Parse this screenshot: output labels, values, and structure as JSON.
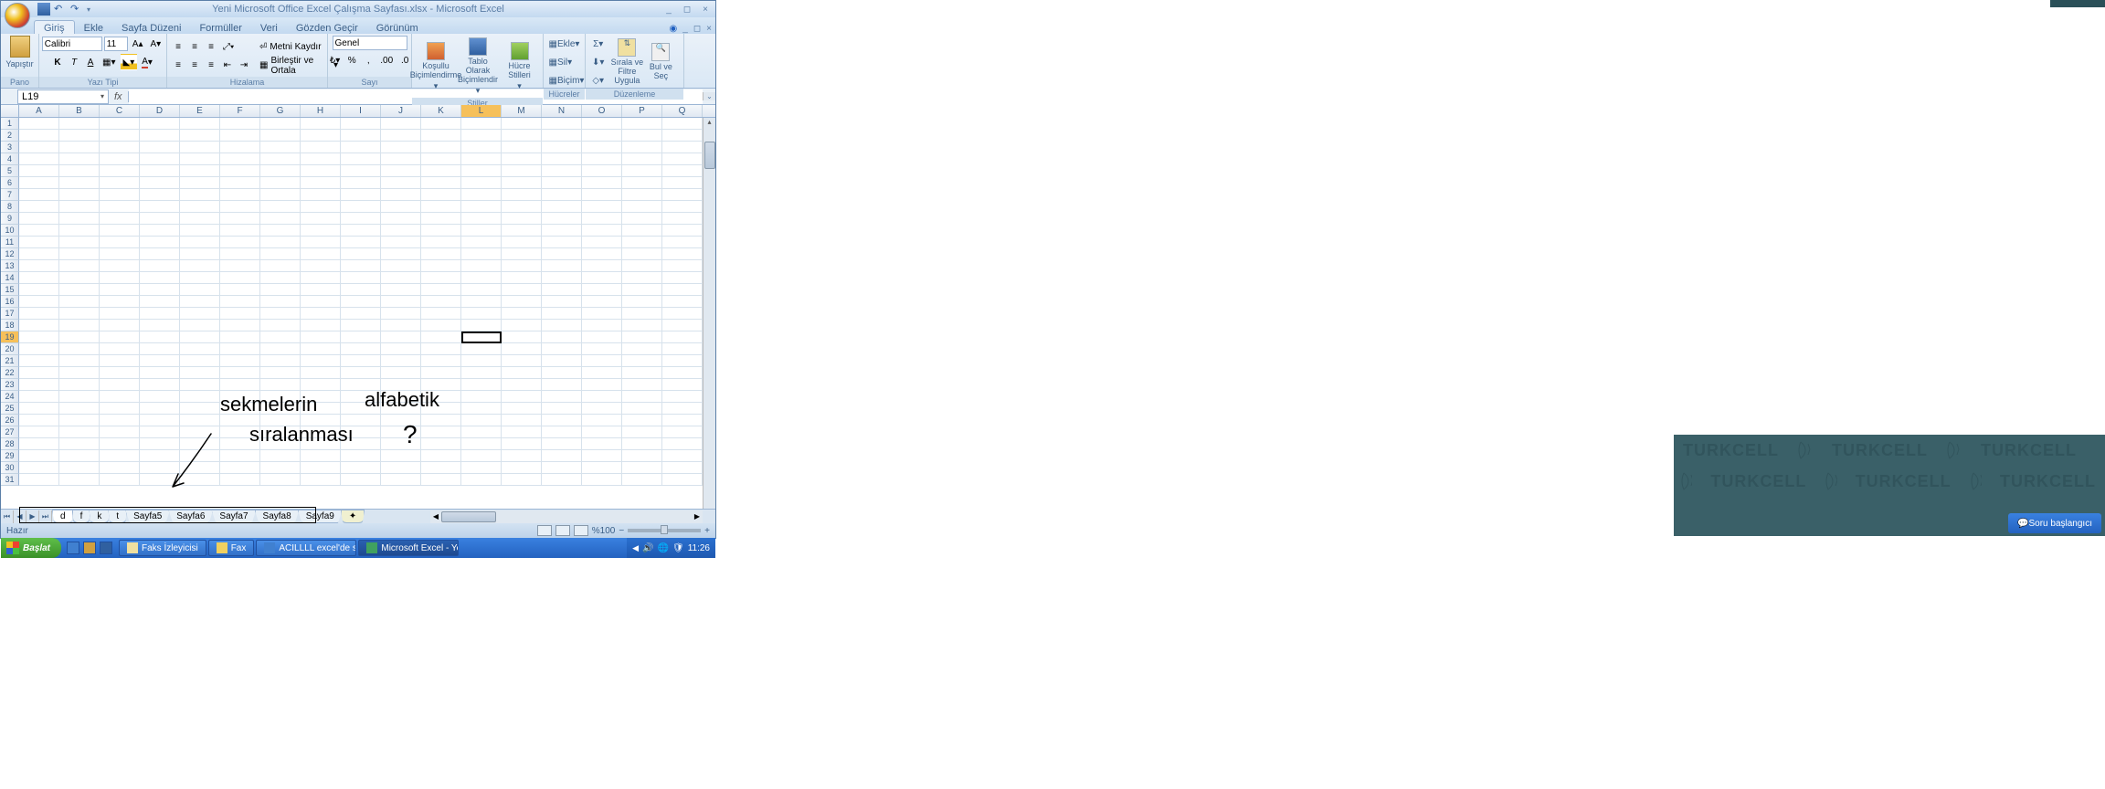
{
  "window": {
    "title": "Yeni Microsoft Office Excel Çalışma Sayfası.xlsx - Microsoft Excel"
  },
  "tabs": {
    "items": [
      "Giriş",
      "Ekle",
      "Sayfa Düzeni",
      "Formüller",
      "Veri",
      "Gözden Geçir",
      "Görünüm"
    ],
    "active": 0
  },
  "ribbon": {
    "clipboard": {
      "paste": "Yapıştır",
      "label": "Pano"
    },
    "font": {
      "name": "Calibri",
      "size": "11",
      "bold": "K",
      "italic": "T",
      "underline": "A",
      "label": "Yazı Tipi"
    },
    "align": {
      "wrap": "Metni Kaydır",
      "merge": "Birleştir ve Ortala",
      "label": "Hizalama"
    },
    "number": {
      "format": "Genel",
      "label": "Sayı"
    },
    "styles": {
      "cond": "Koşullu Biçimlendirme",
      "table": "Tablo Olarak Biçimlendir",
      "cell": "Hücre Stilleri",
      "label": "Stiller"
    },
    "cells": {
      "insert": "Ekle",
      "delete": "Sil",
      "format": "Biçim",
      "label": "Hücreler"
    },
    "editing": {
      "sort": "Sırala ve Filtre Uygula",
      "find": "Bul ve Seç",
      "label": "Düzenleme"
    }
  },
  "namebox": "L19",
  "columns": [
    "A",
    "B",
    "C",
    "D",
    "E",
    "F",
    "G",
    "H",
    "I",
    "J",
    "K",
    "L",
    "M",
    "N",
    "O",
    "P",
    "Q"
  ],
  "active_col": "L",
  "active_row": 19,
  "row_count": 31,
  "handwriting": {
    "line1": "sekmelerin",
    "line2": "sıralanması",
    "line3": "alfabetik",
    "qmark": "?"
  },
  "sheet_tabs": [
    "d",
    "f",
    "k",
    "t",
    "Sayfa5",
    "Sayfa6",
    "Sayfa7",
    "Sayfa8",
    "Sayfa9"
  ],
  "status": {
    "ready": "Hazır",
    "zoom": "%100"
  },
  "taskbar": {
    "start": "Başlat",
    "items": [
      {
        "label": "Faks İzleyicisi",
        "icon": "app"
      },
      {
        "label": "Fax",
        "icon": "folder"
      },
      {
        "label": "ACILLLL excel'de sek...",
        "icon": "ie"
      },
      {
        "label": "Microsoft Excel - Yeni...",
        "icon": "excel",
        "active": true
      }
    ],
    "time": "11:26"
  },
  "watermark": "TURKCELL",
  "chat_hint": "Soru başlangıcı"
}
